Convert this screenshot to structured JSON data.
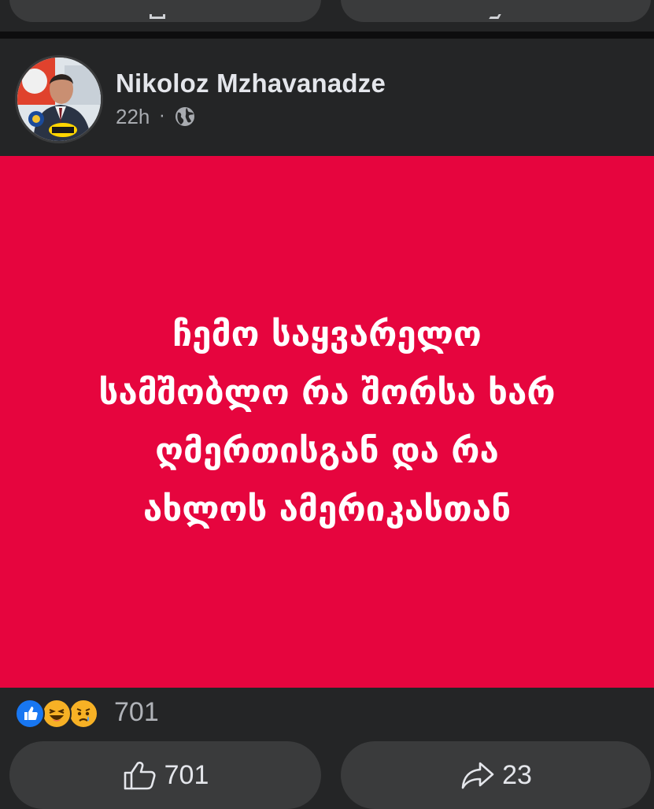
{
  "post": {
    "author": "Nikoloz Mzhavanadze",
    "time": "22h",
    "separator": "·",
    "privacy_icon": "globe-icon",
    "text_lines": [
      "ჩემო საყვარელო",
      "სამშობლო რა შორსა ხარ",
      "ღმერთისგან და რა",
      "ახლოს ამერიკასთან"
    ],
    "background_color": "#e6053e"
  },
  "reactions": {
    "icons": [
      "like-reaction-icon",
      "haha-reaction-icon",
      "sad-reaction-icon"
    ],
    "total": "701"
  },
  "actions": {
    "like_count": "701",
    "share_count": "23"
  }
}
